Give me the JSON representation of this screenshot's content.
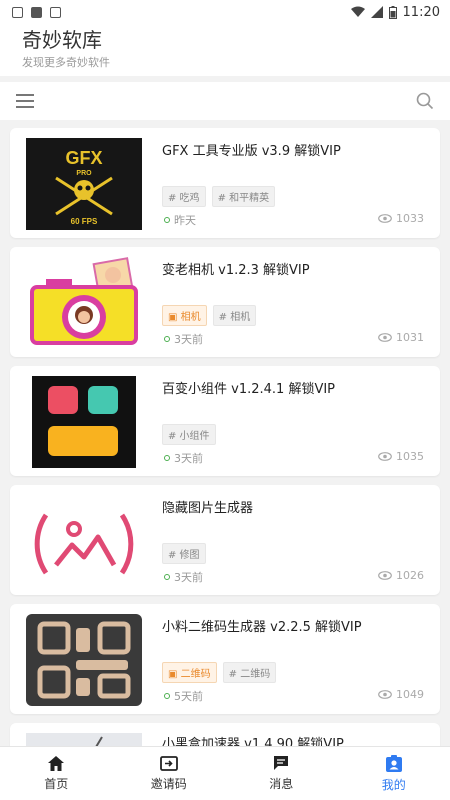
{
  "status_bar": {
    "time": "11:20"
  },
  "header": {
    "title": "奇妙软库",
    "subtitle": "发现更多奇妙软件"
  },
  "apps": [
    {
      "title": "GFX 工具专业版 v3.9 解锁VIP",
      "tags": [
        {
          "label": "# 吃鸡",
          "highlight": false
        },
        {
          "label": "# 和平精英",
          "highlight": false
        }
      ],
      "date": "昨天",
      "views": "1033",
      "icon": "gfx-logo-icon"
    },
    {
      "title": "变老相机 v1.2.3 解锁VIP",
      "tags": [
        {
          "label": "相机",
          "highlight": true
        },
        {
          "label": "# 相机",
          "highlight": false
        }
      ],
      "date": "3天前",
      "views": "1031",
      "icon": "camera-app-icon"
    },
    {
      "title": "百变小组件 v1.2.4.1 解锁VIP",
      "tags": [
        {
          "label": "# 小组件",
          "highlight": false
        }
      ],
      "date": "3天前",
      "views": "1035",
      "icon": "widget-app-icon"
    },
    {
      "title": "隐藏图片生成器",
      "tags": [
        {
          "label": "# 修图",
          "highlight": false
        }
      ],
      "date": "3天前",
      "views": "1026",
      "icon": "image-app-icon"
    },
    {
      "title": "小料二维码生成器 v2.2.5 解锁VIP",
      "tags": [
        {
          "label": "二维码",
          "highlight": true
        },
        {
          "label": "# 二维码",
          "highlight": false
        }
      ],
      "date": "5天前",
      "views": "1049",
      "icon": "qrcode-app-icon"
    },
    {
      "title": "小黑盒加速器 v1.4.90 解锁VIP",
      "tags": [],
      "date": "",
      "views": "",
      "icon": "accelerator-app-icon"
    }
  ],
  "nav": [
    {
      "label": "首页",
      "icon": "home-icon",
      "active": false
    },
    {
      "label": "邀请码",
      "icon": "invite-icon",
      "active": false
    },
    {
      "label": "消息",
      "icon": "message-icon",
      "active": false
    },
    {
      "label": "我的",
      "icon": "profile-icon",
      "active": true
    }
  ],
  "colors": {
    "accent": "#2f7bf1",
    "tag_highlight": "#e98a2d",
    "date_dot": "#4caf50"
  }
}
